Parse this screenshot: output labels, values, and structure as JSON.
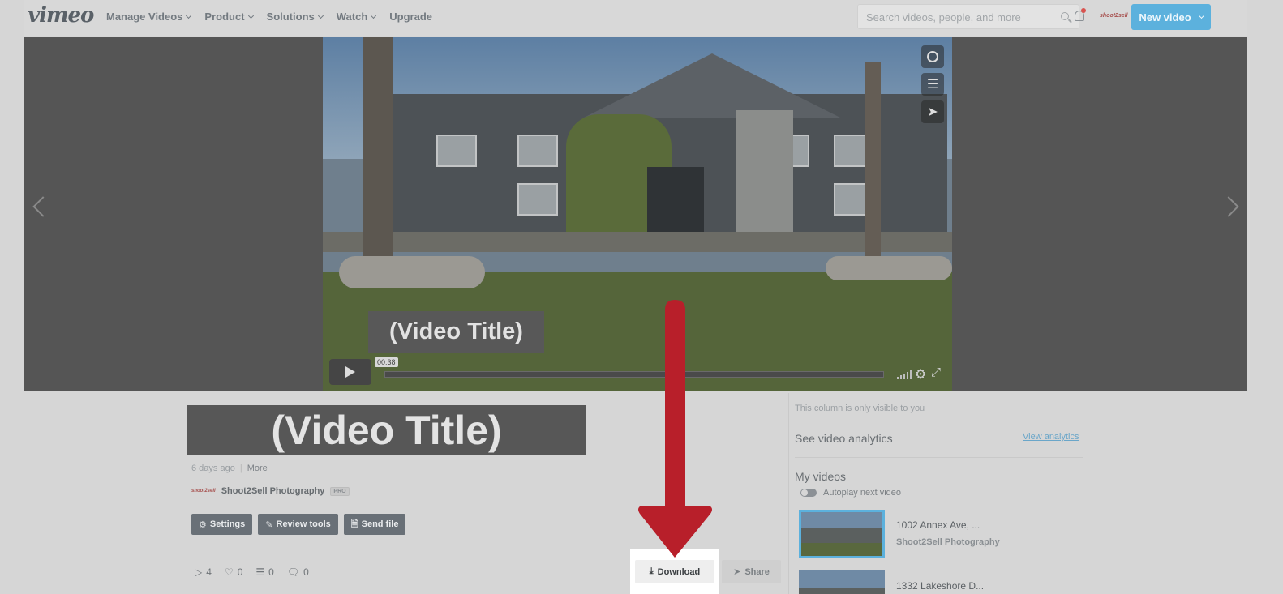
{
  "nav": {
    "logo": "vimeo",
    "items": [
      {
        "label": "Manage Videos",
        "dropdown": true
      },
      {
        "label": "Product",
        "dropdown": true
      },
      {
        "label": "Solutions",
        "dropdown": true
      },
      {
        "label": "Watch",
        "dropdown": true
      },
      {
        "label": "Upgrade",
        "dropdown": false
      }
    ],
    "search_placeholder": "Search videos, people, and more",
    "avatar_text": "shoot2sell",
    "new_video_label": "New video"
  },
  "player": {
    "title_overlay": "(Video Title)",
    "timestamp": "00:38",
    "side_icons": [
      "clock-icon",
      "layers-icon",
      "send-icon"
    ]
  },
  "video_info": {
    "title": "(Video Title)",
    "uploaded": "6 days ago",
    "more_label": "More",
    "owner_logo": "shoot2sell",
    "owner_name": "Shoot2Sell Photography",
    "owner_badge": "PRO",
    "actions": {
      "settings": "Settings",
      "review_tools": "Review tools",
      "send_file": "Send file"
    },
    "stats": {
      "plays": "4",
      "likes": "0",
      "collections": "0",
      "comments": "0"
    },
    "download_label": "Download",
    "share_label": "Share"
  },
  "sidebar": {
    "visibility_note": "This column is only visible to you",
    "analytics_heading": "See video analytics",
    "analytics_link": "View analytics",
    "my_videos_heading": "My videos",
    "autoplay_label": "Autoplay next video",
    "videos": [
      {
        "title": "1002 Annex Ave, ...",
        "owner": "Shoot2Sell Photography"
      },
      {
        "title": "1332 Lakeshore D...",
        "owner": ""
      }
    ]
  },
  "colors": {
    "accent": "#5cb1dd",
    "annotation_arrow": "#b81f2a"
  }
}
